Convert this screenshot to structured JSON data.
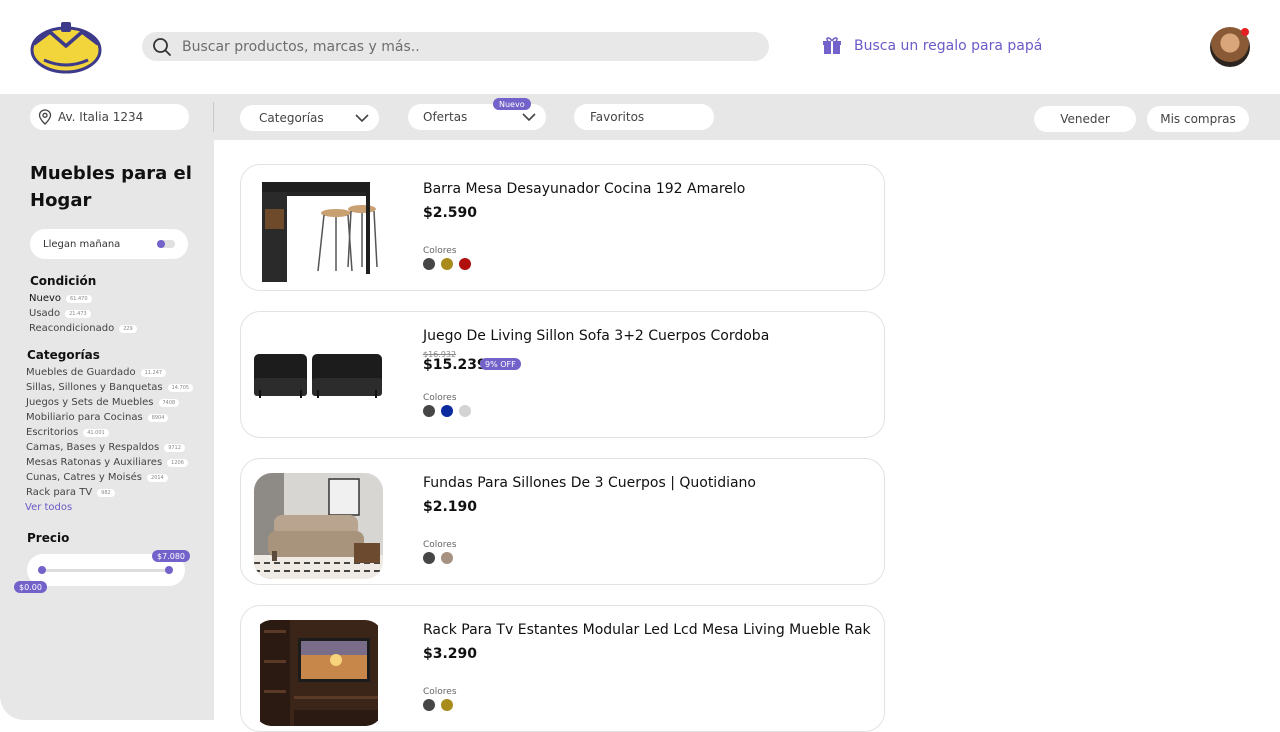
{
  "header": {
    "search_placeholder": "Buscar productos, marcas y más..",
    "promo_text": "Busca un regalo para papá"
  },
  "filterbar": {
    "address": "Av. Italia 1234",
    "categorias": "Categorías",
    "ofertas": "Ofertas",
    "nuevo_badge": "Nuevo",
    "favoritos": "Favoritos",
    "vender": "Veneder",
    "mis_compras": "Mis compras"
  },
  "sidebar": {
    "title": "Muebles para el Hogar",
    "toggle_label": "Llegan mañana",
    "condicion_title": "Condición",
    "condicion": [
      {
        "label": "Nuevo",
        "count": "61.470"
      },
      {
        "label": "Usado",
        "count": "21.473"
      },
      {
        "label": "Reacondicionado",
        "count": "229"
      }
    ],
    "categorias_title": "Categorías",
    "categorias": [
      {
        "label": "Muebles de Guardado",
        "count": "11.247"
      },
      {
        "label": "Sillas, Sillones y Banquetas",
        "count": "14.705"
      },
      {
        "label": "Juegos y Sets de Muebles",
        "count": "7408"
      },
      {
        "label": "Mobiliario para Cocinas",
        "count": "8904"
      },
      {
        "label": "Escritorios",
        "count": "41.001"
      },
      {
        "label": "Camas, Bases y Respaldos",
        "count": "9712"
      },
      {
        "label": "Mesas Ratonas y Auxiliares",
        "count": "1206"
      },
      {
        "label": "Cunas, Catres y Moisés",
        "count": "2014"
      },
      {
        "label": "Rack para TV",
        "count": "982"
      }
    ],
    "ver_todos": "Ver todos",
    "precio_title": "Precio",
    "price_min": "$0.00",
    "price_max": "$7.080"
  },
  "products": [
    {
      "title": "Barra Mesa Desayunador Cocina 192 Amarelo",
      "price": "$2.590",
      "colors_label": "Colores",
      "colors": [
        "#464646",
        "#a88b1a",
        "#b10e0e"
      ]
    },
    {
      "title": "Juego De Living Sillon Sofa 3+2 Cuerpos Cordoba",
      "old_price": "$16.932",
      "price": "$15.239",
      "off": "9% OFF",
      "colors_label": "Colores",
      "colors": [
        "#464646",
        "#0a2a9e",
        "#d3d3d3"
      ]
    },
    {
      "title": "Fundas Para Sillones De 3 Cuerpos | Quotidiano",
      "price": "$2.190",
      "colors_label": "Colores",
      "colors": [
        "#464646",
        "#a79281"
      ]
    },
    {
      "title": "Rack Para Tv Estantes Modular Led Lcd Mesa Living Mueble Rak",
      "price": "$3.290",
      "colors_label": "Colores",
      "colors": [
        "#464646",
        "#a88b1a"
      ]
    }
  ],
  "theme": {
    "accent": "#7262c9",
    "logo_yellow": "#f2d43b",
    "logo_blue": "#3d3a8a"
  }
}
